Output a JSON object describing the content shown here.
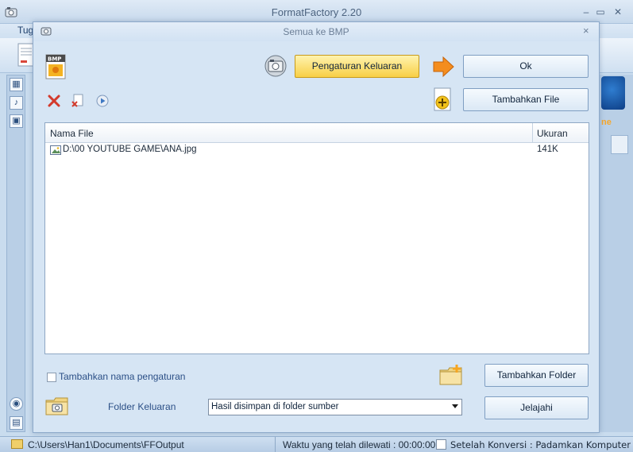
{
  "main_window": {
    "title": "FormatFactory 2.20",
    "menu_first": "Tug",
    "icon": "format-factory-app-icon"
  },
  "dialog": {
    "title": "Semua ke BMP",
    "close_glyph": "×",
    "buttons": {
      "settings": "Pengaturan Keluaran",
      "ok": "Ok",
      "add_file": "Tambahkan File",
      "add_folder": "Tambahkan Folder",
      "browse": "Jelajahi"
    },
    "file_list": {
      "columns": [
        "Nama File",
        "Ukuran"
      ],
      "rows": [
        {
          "name": "D:\\00 YOUTUBE GAME\\ANA.jpg",
          "size": "141K"
        }
      ]
    },
    "add_setting_name": {
      "label": "Tambahkan nama pengaturan",
      "checked": false
    },
    "output_folder": {
      "label": "Folder Keluaran",
      "selected": "Hasil disimpan di folder sumber"
    }
  },
  "statusbar": {
    "output_path": "C:\\Users\\Han1\\Documents\\FFOutput",
    "elapsed": "Waktu yang telah dilewati : 00:00:00",
    "after_conversion": "Setelah Konversi : Padamkan Komputer",
    "after_checked": false
  },
  "right_panel": {
    "ad_text": "ne"
  },
  "colors": {
    "accent_gold": "#f8cf45",
    "dialog_bg": "#d6e5f4",
    "title_text": "#4d6480"
  }
}
